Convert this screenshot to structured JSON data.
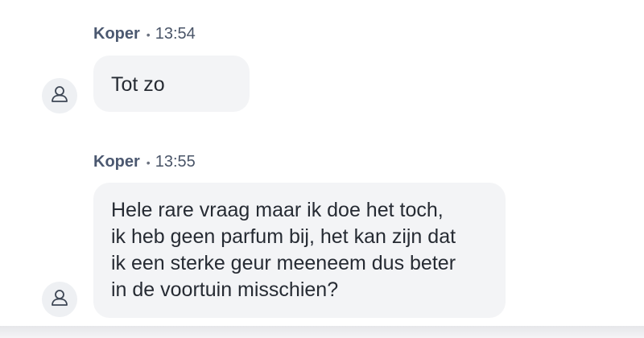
{
  "messages": [
    {
      "sender": "Koper",
      "separator": "•",
      "time": "13:54",
      "avatar_icon": "user-icon",
      "lines": [
        "Tot zo"
      ]
    },
    {
      "sender": "Koper",
      "separator": "•",
      "time": "13:55",
      "avatar_icon": "user-icon",
      "lines": [
        "Hele rare vraag maar ik doe het toch,",
        "ik heb geen parfum bij, het kan zijn dat",
        "ik een sterke geur meeneem dus beter",
        "in de voortuin misschien?"
      ]
    }
  ],
  "colors": {
    "bubble_bg": "#f3f4f6",
    "sender_text": "#4b5870",
    "message_text": "#262b33",
    "avatar_bg": "#eef0f3"
  }
}
